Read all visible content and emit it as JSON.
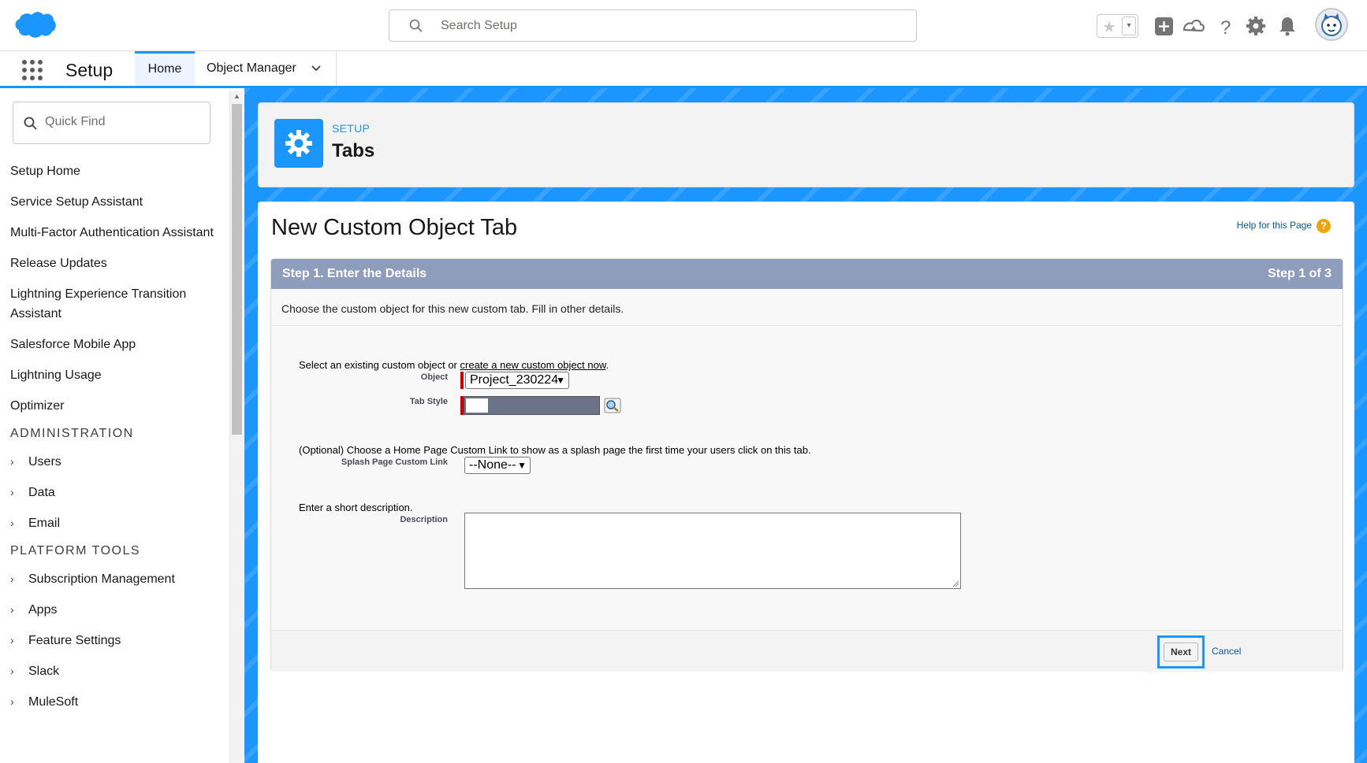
{
  "header": {
    "search_placeholder": "Search Setup"
  },
  "nav": {
    "app_name": "Setup",
    "tabs": [
      {
        "label": "Home"
      },
      {
        "label": "Object Manager"
      }
    ]
  },
  "sidebar": {
    "quick_find_placeholder": "Quick Find",
    "items": [
      "Setup Home",
      "Service Setup Assistant",
      "Multi-Factor Authentication Assistant",
      "Release Updates",
      "Lightning Experience Transition Assistant",
      "Salesforce Mobile App",
      "Lightning Usage",
      "Optimizer"
    ],
    "administration_heading": "ADMINISTRATION",
    "administration_items": [
      "Users",
      "Data",
      "Email"
    ],
    "platform_heading": "PLATFORM TOOLS",
    "platform_items": [
      "Subscription Management",
      "Apps",
      "Feature Settings",
      "Slack",
      "MuleSoft"
    ]
  },
  "page_header": {
    "subtitle": "SETUP",
    "title": "Tabs"
  },
  "content": {
    "title": "New Custom Object Tab",
    "help_link": "Help for this Page",
    "step_title": "Step 1. Enter the Details",
    "step_count": "Step 1 of 3",
    "intro": "Choose the custom object for this new custom tab. Fill in other details.",
    "select_prompt": "Select an existing custom object or",
    "create_link": "create a new custom object now",
    "object_label": "Object",
    "object_value": "Project_230224",
    "tab_style_label": "Tab Style",
    "optional_prompt": "(Optional) Choose a Home Page Custom Link to show as a splash page the first time your users click on this tab.",
    "splash_label": "Splash Page Custom Link",
    "splash_value": "--None--",
    "desc_prompt": "Enter a short description.",
    "desc_label": "Description",
    "next_button": "Next",
    "cancel_link": "Cancel"
  },
  "colors": {
    "brand_blue": "#1b96ff",
    "step_bar": "#8e9dbc",
    "link": "#015ba7"
  }
}
